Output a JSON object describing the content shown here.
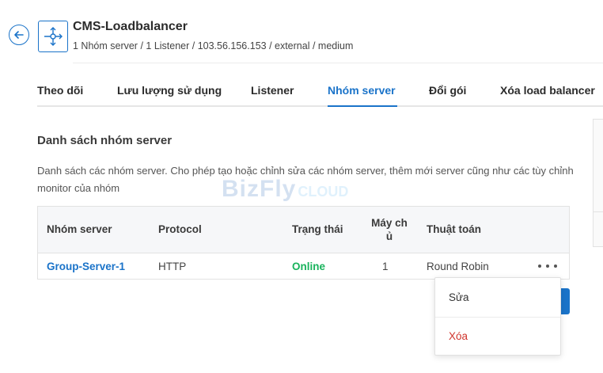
{
  "header": {
    "title": "CMS-Loadbalancer",
    "subtitle": "1 Nhóm server / 1 Listener / 103.56.156.153 / external / medium"
  },
  "tabs": [
    {
      "label": "Theo dõi",
      "active": false
    },
    {
      "label": "Lưu lượng sử dụng",
      "active": false
    },
    {
      "label": "Listener",
      "active": false
    },
    {
      "label": "Nhóm server",
      "active": true
    },
    {
      "label": "Đổi gói",
      "active": false
    },
    {
      "label": "Xóa load balancer",
      "active": false
    }
  ],
  "section": {
    "title": "Danh sách nhóm server",
    "description": "Danh sách các nhóm server. Cho phép tạo hoặc chỉnh sửa các nhóm server, thêm mới server cũng như các tùy chỉnh monitor của nhóm"
  },
  "watermark": {
    "main": "BizFly",
    "sub": "CLOUD"
  },
  "table": {
    "columns": [
      "Nhóm server",
      "Protocol",
      "Trạng thái",
      "Máy chủ",
      "Thuật toán"
    ],
    "header_may_line1": "Máy ch",
    "header_may_line2": "ủ",
    "rows": [
      {
        "name": "Group-Server-1",
        "protocol": "HTTP",
        "status": "Online",
        "servers": "1",
        "algorithm": "Round Robin"
      }
    ]
  },
  "dropdown": {
    "edit_label": "Sửa",
    "delete_label": "Xóa"
  },
  "colors": {
    "accent": "#1a73c9",
    "online": "#19b35c",
    "danger": "#d0342c"
  },
  "icons": {
    "back": "arrow-left-circle-icon",
    "loadbalancer": "load-balancer-icon",
    "more": "more-horizontal-icon"
  }
}
